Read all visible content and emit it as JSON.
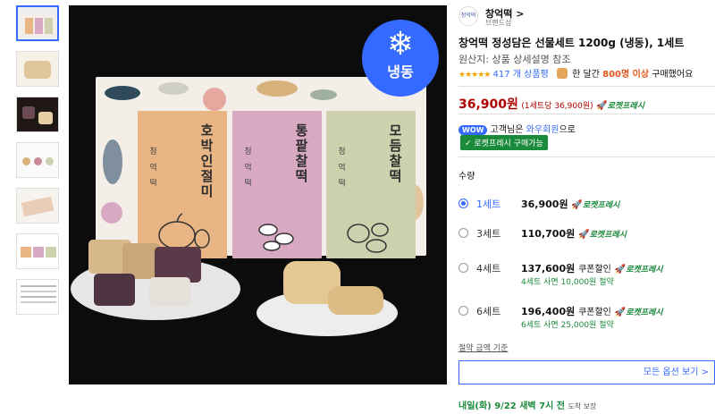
{
  "thumbnails": [
    {
      "name": "thumb-1"
    },
    {
      "name": "thumb-2"
    },
    {
      "name": "thumb-3"
    },
    {
      "name": "thumb-4"
    },
    {
      "name": "thumb-5"
    },
    {
      "name": "thumb-6"
    },
    {
      "name": "thumb-7"
    }
  ],
  "image": {
    "badge_label": "냉동",
    "box_brand": "청 억 떡",
    "packs": [
      {
        "title": "호박인절미",
        "brand": "청 억 떡",
        "color": "#e9b584"
      },
      {
        "title": "통팥찰떡",
        "brand": "청 억 떡",
        "color": "#d9a9c4"
      },
      {
        "title": "모듬찰떡",
        "brand": "청 억 떡",
        "color": "#cdd1ae"
      }
    ]
  },
  "seller": {
    "logo_text": "청억떡",
    "name": "창억떡 >",
    "sub": "브랜드샵"
  },
  "product": {
    "title": "창억떡 정성담은 선물세트 1200g (냉동), 1세트",
    "origin": "원산지: 상품 상세설명 참조",
    "stars": "★★★★★",
    "review_count": "417 개 상품평",
    "buy_prefix": "한 달간",
    "buy_highlight": "800명 이상",
    "buy_suffix": "구매했어요"
  },
  "price": {
    "amount": "36,900원",
    "unit_price": "(1세트당 36,900원)",
    "rocket_label": "로켓프레시"
  },
  "wow": {
    "badge": "WOW",
    "text_prefix": "고객님은",
    "link": "와우회원",
    "text_suffix": "으로"
  },
  "rocket_fresh_badge": "✓ 로켓프레시 구매가능",
  "quantity_label": "수량",
  "options": [
    {
      "name": "1세트",
      "price": "36,900원",
      "coupon": "",
      "rocket": "로켓프레시",
      "sub": "",
      "selected": true
    },
    {
      "name": "3세트",
      "price": "110,700원",
      "coupon": "",
      "rocket": "로켓프레시",
      "sub": "",
      "selected": false
    },
    {
      "name": "4세트",
      "price": "137,600원",
      "coupon": "쿠폰할인",
      "rocket": "로켓프레시",
      "sub": "4세트 사면 10,000원 절약",
      "selected": false
    },
    {
      "name": "6세트",
      "price": "196,400원",
      "coupon": "쿠폰할인",
      "rocket": "로켓프레시",
      "sub": "6세트 사면 25,000원 절약",
      "selected": false
    }
  ],
  "savings_basis": "절약 금액 기준",
  "all_options_button": "모든 옵션 보기 >",
  "delivery": {
    "date": "내일(화) 9/22 새벽 7시 전",
    "note": "도착 보장"
  },
  "colors": {
    "accent": "#346aff",
    "price_red": "#ae0000",
    "rocket_green": "#1a8a3b"
  }
}
